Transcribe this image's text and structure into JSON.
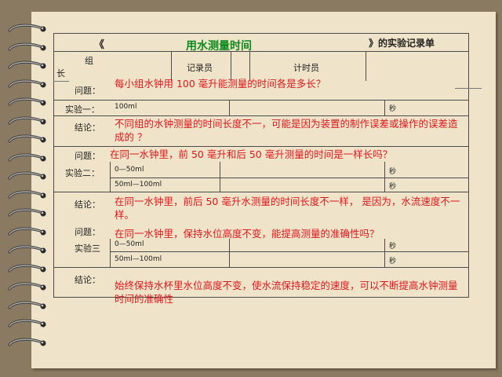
{
  "header": {
    "bracket_open": "《",
    "title": "用水测量时间",
    "suffix": "》的实验记录单"
  },
  "info": {
    "leader": "组长",
    "recorder": "记录员",
    "timer": "计时员"
  },
  "q0": {
    "label": "问题：",
    "text": "每小组水钟用 100 毫升能测量的时间各是多长？"
  },
  "exp1": {
    "label": "实验一：",
    "amount": "100ml",
    "unit": "秒"
  },
  "c1": {
    "label": "结论：",
    "text": "不同组的水钟测量的时间长度不一，可能是因为装置的制作误差或操作的误差造成的 ？"
  },
  "q2": {
    "label": "问题：",
    "text": "在同一水钟里，前 50 毫升和后 50 毫升测量的时间是一样长吗？"
  },
  "exp2": {
    "label": "实验二：",
    "row1": "0—50ml",
    "row2": "50ml—100ml",
    "unit1": "秒",
    "unit2": "秒"
  },
  "c2": {
    "label": "结论：",
    "text": "在同一水钟里，前后 50 毫升水测量的时间长度不一样， 是因为，水流速度不一样。"
  },
  "q3": {
    "label": "问题：",
    "text": "在同一水钟里，保持水位高度不变，能提高测量的准确性吗？"
  },
  "exp3": {
    "label": "实验三",
    "row1": "0—50ml",
    "row2": "50ml—100ml",
    "unit1": "秒",
    "unit2": "秒"
  },
  "c3": {
    "label": "结论：",
    "text": "始终保持水杯里水位高度不变，使水流保持稳定的速度，可以不断提高水钟测量时间的准确性"
  }
}
